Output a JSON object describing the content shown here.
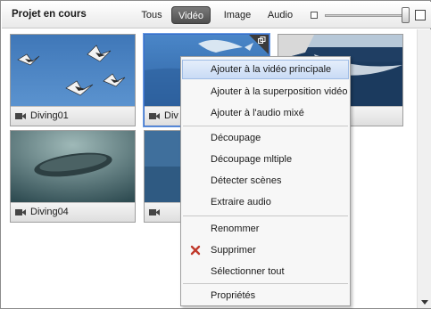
{
  "header": {
    "title": "Projet en cours",
    "tabs": [
      {
        "id": "tous",
        "label": "Tous",
        "active": false
      },
      {
        "id": "video",
        "label": "Vidéo",
        "active": true
      },
      {
        "id": "image",
        "label": "Image",
        "active": false
      },
      {
        "id": "audio",
        "label": "Audio",
        "active": false
      }
    ],
    "zoom": {
      "level": 0.95
    }
  },
  "media": [
    {
      "name": "Diving01",
      "type": "video",
      "icon": "video-camera-icon"
    },
    {
      "name": "Div",
      "type": "video",
      "icon": "video-camera-icon",
      "selected": true,
      "badge": "multi-segment-icon"
    },
    {
      "name": "",
      "type": "video",
      "icon": "video-camera-icon"
    },
    {
      "name": "Diving04",
      "type": "video",
      "icon": "video-camera-icon"
    },
    {
      "name": "",
      "type": "video",
      "icon": "video-camera-icon"
    }
  ],
  "context_menu": {
    "items": [
      {
        "label": "Ajouter à la vidéo principale",
        "highlighted": true
      },
      {
        "label": "Ajouter à la superposition vidéo"
      },
      {
        "label": "Ajouter à l'audio mixé"
      },
      {
        "label": "Découpage"
      },
      {
        "label": "Découpage mltiple"
      },
      {
        "label": "Détecter scènes"
      },
      {
        "label": "Extraire audio"
      },
      {
        "label": "Renommer"
      },
      {
        "label": "Supprimer",
        "icon": "delete-x-icon"
      },
      {
        "label": "Sélectionner tout"
      },
      {
        "label": "Propriétés"
      }
    ]
  },
  "colors": {
    "accent": "#3c70c9",
    "delete_icon": "#c0392b",
    "active_tab": "#5c5c5c"
  }
}
